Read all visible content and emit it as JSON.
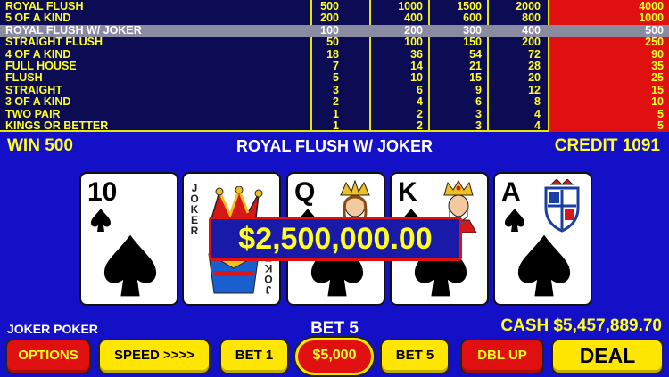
{
  "paytable": {
    "rows": [
      {
        "name": "ROYAL FLUSH",
        "values": [
          "500",
          "1000",
          "1500",
          "2000",
          "4000"
        ]
      },
      {
        "name": "5 OF A KIND",
        "values": [
          "200",
          "400",
          "600",
          "800",
          "1000"
        ]
      },
      {
        "name": "ROYAL FLUSH W/ JOKER",
        "values": [
          "100",
          "200",
          "300",
          "400",
          "500"
        ]
      },
      {
        "name": "STRAIGHT FLUSH",
        "values": [
          "50",
          "100",
          "150",
          "200",
          "250"
        ]
      },
      {
        "name": "4 OF A KIND",
        "values": [
          "18",
          "36",
          "54",
          "72",
          "90"
        ]
      },
      {
        "name": "FULL HOUSE",
        "values": [
          "7",
          "14",
          "21",
          "28",
          "35"
        ]
      },
      {
        "name": "FLUSH",
        "values": [
          "5",
          "10",
          "15",
          "20",
          "25"
        ]
      },
      {
        "name": "STRAIGHT",
        "values": [
          "3",
          "6",
          "9",
          "12",
          "15"
        ]
      },
      {
        "name": "3 OF A KIND",
        "values": [
          "2",
          "4",
          "6",
          "8",
          "10"
        ]
      },
      {
        "name": "TWO PAIR",
        "values": [
          "1",
          "2",
          "3",
          "4",
          "5"
        ]
      },
      {
        "name": "KINGS OR BETTER",
        "values": [
          "1",
          "2",
          "3",
          "4",
          "5"
        ]
      }
    ],
    "highlighted_row": "ROYAL FLUSH W/ JOKER"
  },
  "status": {
    "win": "WIN 500",
    "hand": "ROYAL FLUSH W/ JOKER",
    "credit": "CREDIT 1091"
  },
  "cards": [
    {
      "rank": "10",
      "suit": "spades"
    },
    {
      "rank": "JOKER",
      "suit": "joker"
    },
    {
      "rank": "Q",
      "suit": "spades"
    },
    {
      "rank": "K",
      "suit": "spades"
    },
    {
      "rank": "A",
      "suit": "spades"
    }
  ],
  "banner": "$2,500,000.00",
  "info": {
    "game_name": "JOKER POKER",
    "bet": "BET 5",
    "cash": "CASH $5,457,889.70"
  },
  "buttons": {
    "options": "OPTIONS",
    "speed": "SPEED >>>>",
    "bet1": "BET 1",
    "denom": "$5,000",
    "bet5": "BET 5",
    "dblup": "DBL UP",
    "deal": "DEAL"
  },
  "colors": {
    "background": "#1410c8",
    "paytable_bg": "#0c0c55",
    "highlight_column": "#e01010",
    "text_yellow": "#ffff20"
  }
}
